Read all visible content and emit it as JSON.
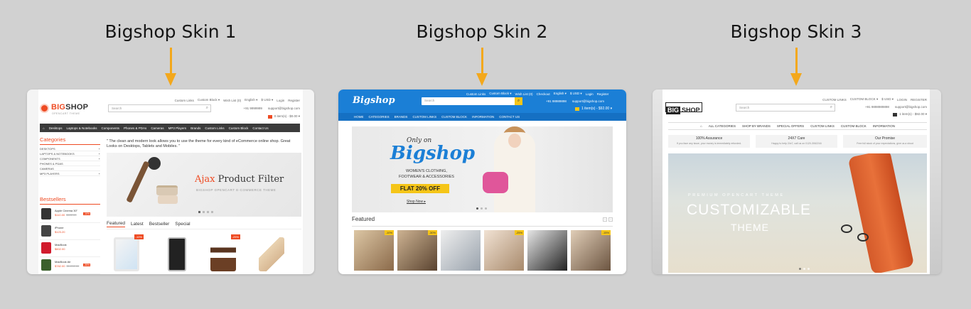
{
  "titles": [
    "Bigshop Skin 1",
    "Bigshop Skin 2",
    "Bigshop Skin 3"
  ],
  "colors": {
    "arrow": "#f3a81c",
    "skin1_accent": "#ee4b23",
    "skin2_accent": "#1b7fd6",
    "skin2_highlight": "#f5c518"
  },
  "skin1": {
    "top_links": [
      "Custom Links",
      "Custom Block ▾",
      "Wish List (0)",
      "English ▾",
      "$ USD ▾",
      "Login",
      "Register"
    ],
    "logo_big": "BIG",
    "logo_shop": "SHOP",
    "logo_sub": "OPENCART THEME",
    "search_placeholder": "Search",
    "phone": "+91 9999999",
    "email": "support@bigshop.com",
    "cart": "0 item(s) - $0.00 ▾",
    "nav": [
      "⌂",
      "Desktops",
      "Laptops & Notebooks",
      "Components",
      "Phones & PDAs",
      "Cameras",
      "MP3 Players",
      "Brands",
      "Custom Links",
      "Custom Block",
      "Contact Us"
    ],
    "categories_title": "Categories",
    "categories": [
      "DESKTOPS",
      "LAPTOPS & NOTEBOOKS",
      "COMPONENTS",
      "PHONES & PDAS",
      "CAMERAS",
      "MP3 PLAYERS"
    ],
    "bestsellers_title": "Bestsellers",
    "bestsellers": [
      {
        "name": "Apple Cinema 30\"",
        "price": "$110.00",
        "old": "$122.00",
        "badge": "-10%"
      },
      {
        "name": "iPhone",
        "price": "$123.20",
        "old": "",
        "badge": ""
      },
      {
        "name": "MacBook",
        "price": "$602.00",
        "old": "",
        "badge": ""
      },
      {
        "name": "MacBook Air",
        "price": "$782.00",
        "old": "$1,202.00",
        "badge": "-35%"
      }
    ],
    "tagline": "\" The clean and modern look allows you to use the theme for every kind of eCommerce online shop. Great Looks on Desktops, Tablets and Mobiles. \"",
    "banner_title_a": "Ajax",
    "banner_title_b": "Product Filter",
    "banner_sub": "BIGSHOP OPENCART E-COMMERCE THEME",
    "tabs": [
      "Featured",
      "Latest",
      "Bestseller",
      "Special"
    ],
    "product_badges": [
      "-10%",
      "-25%"
    ]
  },
  "skin2": {
    "logo": "Bigshop",
    "top_links": [
      "Custom Links",
      "Custom Block ▾",
      "Wish List (0)",
      "Checkout",
      "English ▾",
      "$ USD ▾",
      "Login",
      "Register"
    ],
    "search_placeholder": "Search",
    "phone": "+91 98989898",
    "email": "support@bigshop.com",
    "cart": "1 item(s) - $92.00 ▾",
    "nav": [
      "HOME",
      "CATEGORIES",
      "BRANDS",
      "CUSTOM LINKS",
      "CUSTOM BLOCK",
      "INFORMATION",
      "CONTACT US"
    ],
    "banner_only": "Only on",
    "banner_brand": "Bigshop",
    "banner_line1": "WOMEN'S CLOTHING,",
    "banner_line2": "FOOTWEAR & ACCESSORIES",
    "banner_offer": "FLAT 20% OFF",
    "banner_cta": "Shop Now ▸",
    "featured_title": "Featured",
    "product_badges": [
      "-10%",
      "-30%",
      "",
      "-25%",
      "",
      "-15%"
    ]
  },
  "skin3": {
    "logo_a": "BIG",
    "logo_b": "SHOP",
    "top_links": [
      "CUSTOM LINKS",
      "CUSTOM BLOCK ▾",
      "$ USD ▾",
      "LOGIN",
      "REGISTER"
    ],
    "search_placeholder": "Search",
    "phone": "+91 9898989898",
    "email": "support@bigshop.com",
    "cart": "1 item(s) - $92.00 ▾",
    "nav": [
      "⌂",
      "ALL CATEGORIES",
      "SHOP BY BRANDS",
      "SPECIAL OFFERS",
      "CUSTOM LINKS",
      "CUSTOM BLOCK",
      "INFORMATION"
    ],
    "assurances": [
      {
        "title": "100% Assurance",
        "desc": "If you face any issue, your money is immediately refunded."
      },
      {
        "title": "24X7 Care",
        "desc": "Happy to help 24x7, call us on 0120-3062244"
      },
      {
        "title": "Our Promise",
        "desc": "Free full stock of your expectations, give us a shout"
      }
    ],
    "hero_pre": "PREMIUM OPENCART THEME",
    "hero_big": "CUSTOMIZABLE",
    "hero_theme": "THEME"
  }
}
